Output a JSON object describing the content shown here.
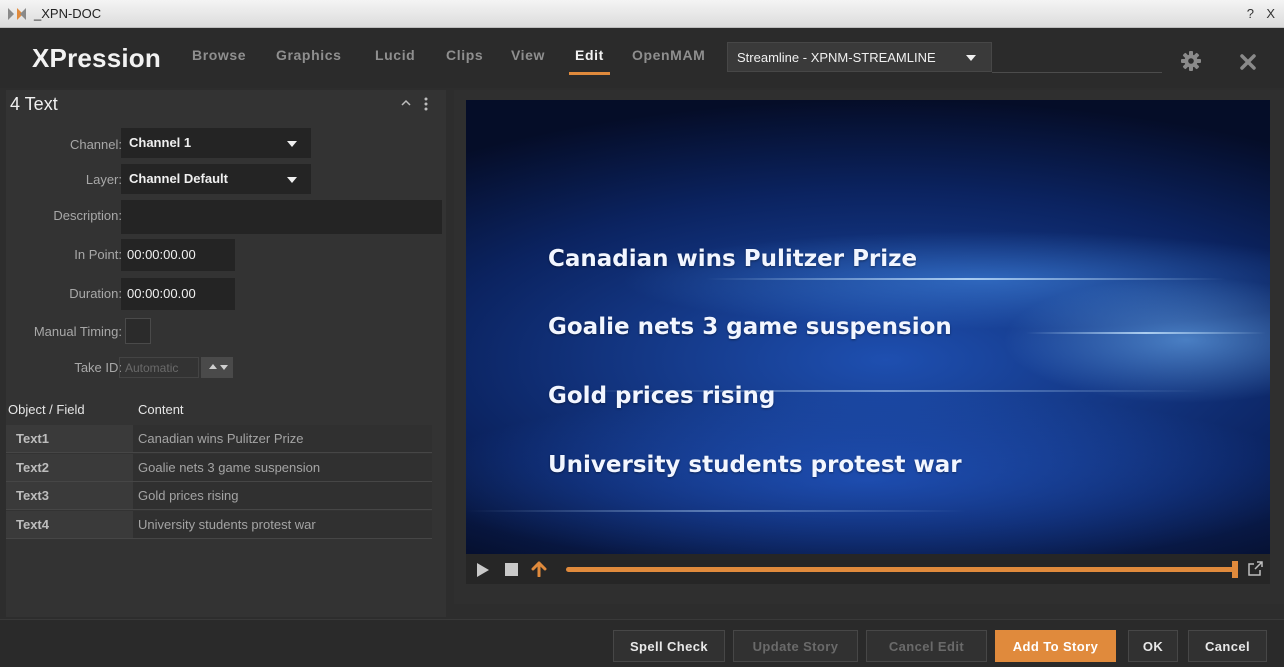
{
  "window": {
    "title": "_XPN-DOC",
    "help": "?",
    "close": "X"
  },
  "header": {
    "brand": "XPression",
    "tabs": [
      {
        "label": "Browse",
        "active": false
      },
      {
        "label": "Graphics",
        "active": false
      },
      {
        "label": "Lucid",
        "active": false
      },
      {
        "label": "Clips",
        "active": false
      },
      {
        "label": "View",
        "active": false
      },
      {
        "label": "Edit",
        "active": true
      },
      {
        "label": "OpenMAM",
        "active": false
      }
    ],
    "layout_select": "Streamline - XPNM-STREAMLINE",
    "accent_color": "#e08a3c"
  },
  "panel": {
    "title": "4 Text",
    "channel_label": "Channel:",
    "channel_value": "Channel 1",
    "layer_label": "Layer:",
    "layer_value": "Channel Default",
    "description_label": "Description:",
    "description_value": "",
    "in_point_label": "In Point:",
    "in_point_value": "00:00:00.00",
    "duration_label": "Duration:",
    "duration_value": "00:00:00.00",
    "manual_timing_label": "Manual Timing:",
    "manual_timing_checked": false,
    "take_id_label": "Take ID:",
    "take_id_value": "Automatic"
  },
  "fields_table": {
    "headers": [
      "Object / Field",
      "Content"
    ],
    "rows": [
      {
        "field": "Text1",
        "content": "Canadian wins Pulitzer Prize"
      },
      {
        "field": "Text2",
        "content": "Goalie nets 3 game suspension"
      },
      {
        "field": "Text3",
        "content": "Gold prices rising"
      },
      {
        "field": "Text4",
        "content": "University students protest war"
      }
    ]
  },
  "preview": {
    "headlines": [
      "Canadian wins Pulitzer Prize",
      "Goalie nets 3 game suspension",
      "Gold prices rising",
      "University students protest war"
    ],
    "scrub_position": 1.0
  },
  "footer": {
    "spell_check": "Spell Check",
    "update_story": "Update Story",
    "cancel_edit": "Cancel Edit",
    "add_to_story": "Add To Story",
    "ok": "OK",
    "cancel": "Cancel"
  }
}
